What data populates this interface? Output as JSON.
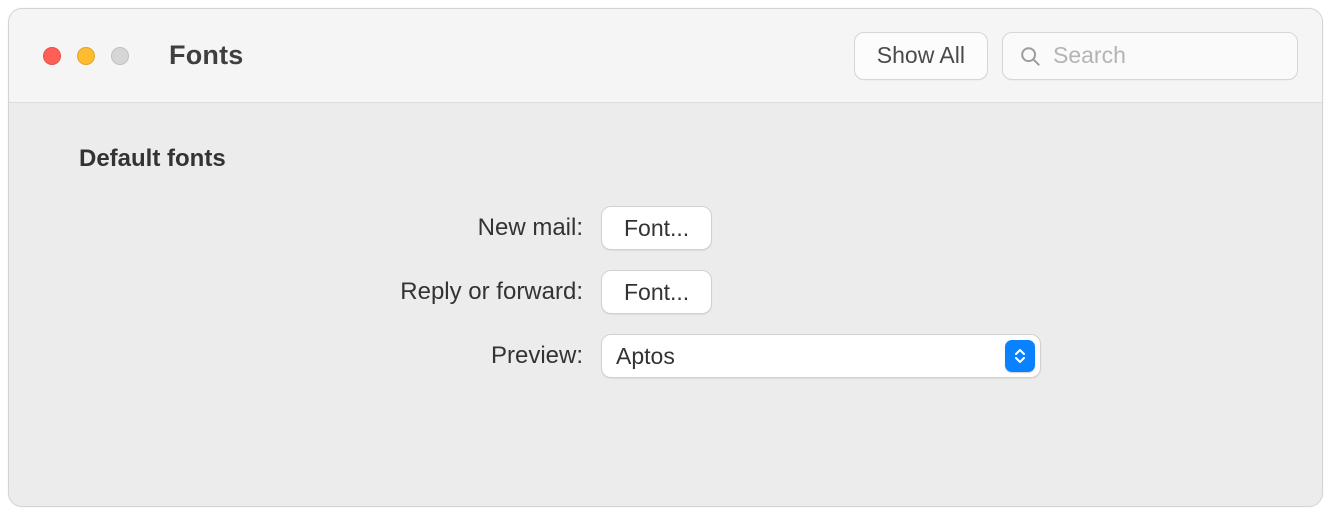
{
  "window": {
    "title": "Fonts"
  },
  "toolbar": {
    "show_all_label": "Show All",
    "search_placeholder": "Search"
  },
  "section": {
    "heading": "Default fonts"
  },
  "rows": {
    "new_mail": {
      "label": "New mail:",
      "button": "Font..."
    },
    "reply_forward": {
      "label": "Reply or forward:",
      "button": "Font..."
    },
    "preview": {
      "label": "Preview:",
      "value": "Aptos"
    }
  }
}
